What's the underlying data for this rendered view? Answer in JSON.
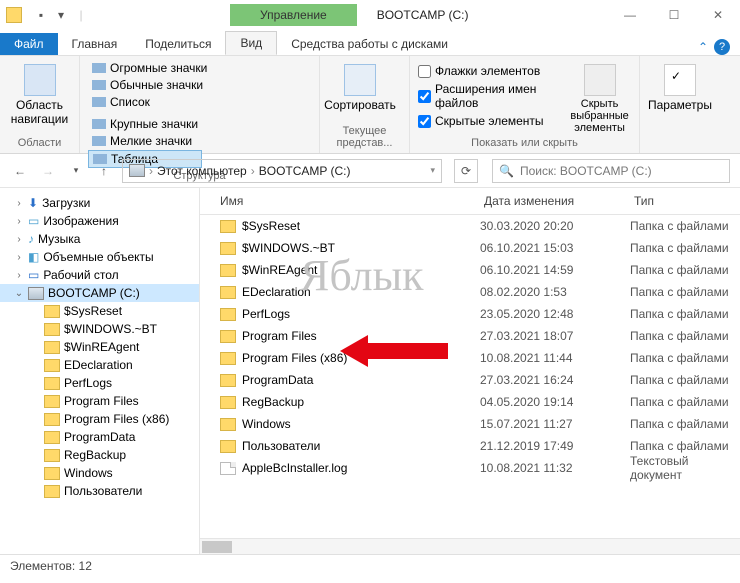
{
  "title": "BOOTCAMP (C:)",
  "manage": "Управление",
  "tabs": {
    "file": "Файл",
    "home": "Главная",
    "share": "Поделиться",
    "view": "Вид",
    "disk": "Средства работы с дисками"
  },
  "ribbon": {
    "nav": {
      "label": "Область навигации",
      "group": "Области"
    },
    "layouts": {
      "huge": "Огромные значки",
      "large": "Крупные значки",
      "medium": "Обычные значки",
      "small": "Мелкие значки",
      "list": "Список",
      "table": "Таблица",
      "group": "Структура"
    },
    "sort": {
      "label": "Сортировать",
      "group": "Текущее представ..."
    },
    "show": {
      "flags": "Флажки элементов",
      "ext": "Расширения имен файлов",
      "hidden": "Скрытые элементы",
      "hide": "Скрыть выбранные элементы",
      "group": "Показать или скрыть"
    },
    "options": {
      "label": "Параметры"
    }
  },
  "breadcrumb": {
    "pc": "Этот компьютер",
    "drive": "BOOTCAMP (C:)"
  },
  "search_placeholder": "Поиск: BOOTCAMP (C:)",
  "columns": {
    "name": "Имя",
    "date": "Дата изменения",
    "type": "Тип"
  },
  "tree": {
    "downloads": "Загрузки",
    "images": "Изображения",
    "music": "Музыка",
    "objects": "Объемные объекты",
    "desktop": "Рабочий стол",
    "drive": "BOOTCAMP (C:)",
    "items": [
      "$SysReset",
      "$WINDOWS.~BT",
      "$WinREAgent",
      "EDeclaration",
      "PerfLogs",
      "Program Files",
      "Program Files (x86)",
      "ProgramData",
      "RegBackup",
      "Windows",
      "Пользователи"
    ]
  },
  "rows": [
    {
      "name": "$SysReset",
      "date": "30.03.2020 20:20",
      "type": "Папка с файлами",
      "kind": "folder"
    },
    {
      "name": "$WINDOWS.~BT",
      "date": "06.10.2021 15:03",
      "type": "Папка с файлами",
      "kind": "folder"
    },
    {
      "name": "$WinREAgent",
      "date": "06.10.2021 14:59",
      "type": "Папка с файлами",
      "kind": "folder"
    },
    {
      "name": "EDeclaration",
      "date": "08.02.2020 1:53",
      "type": "Папка с файлами",
      "kind": "folder"
    },
    {
      "name": "PerfLogs",
      "date": "23.05.2020 12:48",
      "type": "Папка с файлами",
      "kind": "folder"
    },
    {
      "name": "Program Files",
      "date": "27.03.2021 18:07",
      "type": "Папка с файлами",
      "kind": "folder"
    },
    {
      "name": "Program Files (x86)",
      "date": "10.08.2021 11:44",
      "type": "Папка с файлами",
      "kind": "folder"
    },
    {
      "name": "ProgramData",
      "date": "27.03.2021 16:24",
      "type": "Папка с файлами",
      "kind": "folder"
    },
    {
      "name": "RegBackup",
      "date": "04.05.2020 19:14",
      "type": "Папка с файлами",
      "kind": "folder"
    },
    {
      "name": "Windows",
      "date": "15.07.2021 11:27",
      "type": "Папка с файлами",
      "kind": "folder"
    },
    {
      "name": "Пользователи",
      "date": "21.12.2019 17:49",
      "type": "Папка с файлами",
      "kind": "folder"
    },
    {
      "name": "AppleBcInstaller.log",
      "date": "10.08.2021 11:32",
      "type": "Текстовый документ",
      "kind": "file"
    }
  ],
  "status": "Элементов: 12",
  "watermark": "Яблык"
}
